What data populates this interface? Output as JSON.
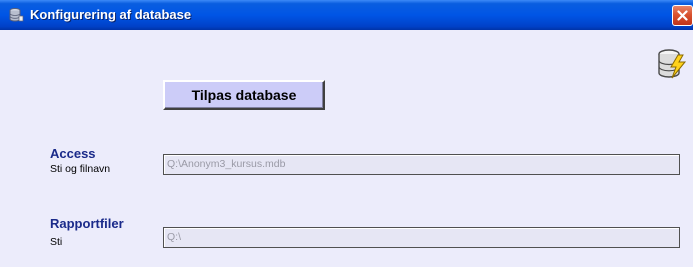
{
  "window": {
    "title": "Konfigurering af database",
    "title_icon": "database-icon",
    "close_icon": "close-icon"
  },
  "toolbar": {
    "corner_icon": "database-lightning-icon",
    "tilpas_label": "Tilpas database"
  },
  "access": {
    "title": "Access",
    "subtitle": "Sti og filnavn",
    "value": "Q:\\Anonym3_kursus.mdb"
  },
  "rapportfiler": {
    "title": "Rapportfiler",
    "subtitle": "Sti",
    "value": "Q:\\"
  },
  "colors": {
    "titlebar": "#0055e5",
    "client_bg": "#ececfb",
    "button_bg": "#ccccf8",
    "section_title": "#1a2a8a",
    "close_button": "#d9532f"
  }
}
